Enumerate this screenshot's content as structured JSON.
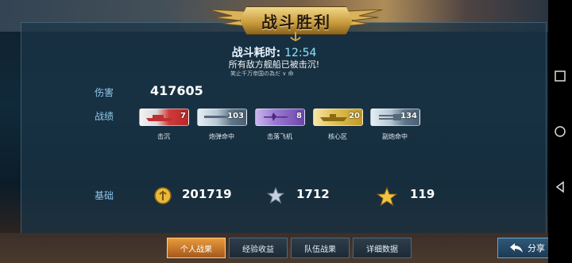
{
  "emblem": {
    "title": "战斗胜利"
  },
  "battle": {
    "duration_label": "战斗耗时:",
    "duration_value": "12:54",
    "result": "所有敌方舰船已被击沉!",
    "ticker": "笑止千万帝国の為だ  ∨  命"
  },
  "stats": {
    "damage_label": "伤害",
    "damage_value": "417605",
    "record_label": "战绩",
    "records": [
      {
        "caption": "击沉",
        "value": "7",
        "color": "#d23a3a",
        "icon": "ship-icon"
      },
      {
        "caption": "炮弹命中",
        "value": "103",
        "color": "#6a7f93",
        "icon": "shell-icon"
      },
      {
        "caption": "击落飞机",
        "value": "8",
        "color": "#7b4fb8",
        "icon": "plane-icon"
      },
      {
        "caption": "核心区",
        "value": "20",
        "color": "#c8a02a",
        "icon": "core-icon"
      },
      {
        "caption": "副炮命中",
        "value": "134",
        "color": "#6a7f93",
        "icon": "secondary-gun-icon"
      }
    ],
    "base_label": "基础",
    "base": [
      {
        "value": "201719",
        "icon": "gold-coin-icon"
      },
      {
        "value": "1712",
        "icon": "silver-star-icon"
      },
      {
        "value": "119",
        "icon": "gold-star-icon"
      }
    ]
  },
  "tabs": [
    "个人战果",
    "经验收益",
    "队伍战果",
    "详细数据"
  ],
  "active_tab": "个人战果",
  "share_label": "分享"
}
